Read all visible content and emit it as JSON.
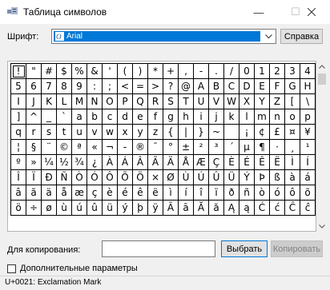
{
  "window": {
    "title": "Таблица символов",
    "icon": "charmap-app-icon",
    "minimize_glyph": "—",
    "maximize_glyph": "☐"
  },
  "font": {
    "label": "Шрифт:",
    "selected": "Arial",
    "icon": "opentype-font-icon",
    "help_label": "Справка"
  },
  "grid": {
    "selected_index": 0,
    "rows": [
      [
        "!",
        "\"",
        "#",
        "$",
        "%",
        "&",
        "'",
        "(",
        ")",
        "*",
        "+",
        ",",
        "-",
        ".",
        "/",
        "0",
        "1",
        "2",
        "3",
        "4"
      ],
      [
        "5",
        "6",
        "7",
        "8",
        "9",
        ":",
        ";",
        "<",
        "=",
        ">",
        "?",
        "@",
        "A",
        "B",
        "C",
        "D",
        "E",
        "F",
        "G",
        "H"
      ],
      [
        "I",
        "J",
        "K",
        "L",
        "M",
        "N",
        "O",
        "P",
        "Q",
        "R",
        "S",
        "T",
        "U",
        "V",
        "W",
        "X",
        "Y",
        "Z",
        "[",
        "\\"
      ],
      [
        "]",
        "^",
        "_",
        "`",
        "a",
        "b",
        "c",
        "d",
        "e",
        "f",
        "g",
        "h",
        "i",
        "j",
        "k",
        "l",
        "m",
        "n",
        "o",
        "p"
      ],
      [
        "q",
        "r",
        "s",
        "t",
        "u",
        "v",
        "w",
        "x",
        "y",
        "z",
        "{",
        "|",
        "}",
        "~",
        " ",
        "¡",
        "¢",
        "£",
        "¤",
        "¥"
      ],
      [
        "¦",
        "§",
        "¨",
        "©",
        "ª",
        "«",
        "¬",
        "-",
        "®",
        "¯",
        "°",
        "±",
        "²",
        "³",
        "´",
        "µ",
        "¶",
        "·",
        "¸",
        "¹"
      ],
      [
        "º",
        "»",
        "¼",
        "½",
        "¾",
        "¿",
        "À",
        "Á",
        "Â",
        "Ã",
        "Ä",
        "Å",
        "Æ",
        "Ç",
        "È",
        "É",
        "Ê",
        "Ë",
        "Ì",
        "Í"
      ],
      [
        "Î",
        "Ï",
        "Ð",
        "Ñ",
        "Ò",
        "Ó",
        "Ô",
        "Õ",
        "Ö",
        "×",
        "Ø",
        "Ù",
        "Ú",
        "Û",
        "Ü",
        "Ý",
        "Þ",
        "ß",
        "à",
        "á"
      ],
      [
        "â",
        "ã",
        "ä",
        "å",
        "æ",
        "ç",
        "è",
        "é",
        "ê",
        "ë",
        "ì",
        "í",
        "î",
        "ï",
        "ð",
        "ñ",
        "ò",
        "ó",
        "ô",
        "õ"
      ],
      [
        "ö",
        "÷",
        "ø",
        "ù",
        "ú",
        "û",
        "ü",
        "ý",
        "þ",
        "ÿ",
        "Ā",
        "ā",
        "Ă",
        "ă",
        "Ą",
        "ą",
        "Ć",
        "ć",
        "Ĉ",
        "ĉ"
      ]
    ]
  },
  "copy": {
    "label": "Для копирования:",
    "value": "",
    "select_label": "Выбрать",
    "copy_label": "Копировать"
  },
  "advanced": {
    "label": "Дополнительные параметры",
    "checked": false
  },
  "status": {
    "text": "U+0021: Exclamation Mark"
  },
  "colors": {
    "accent": "#0078d7",
    "disabled_text": "#838383"
  }
}
